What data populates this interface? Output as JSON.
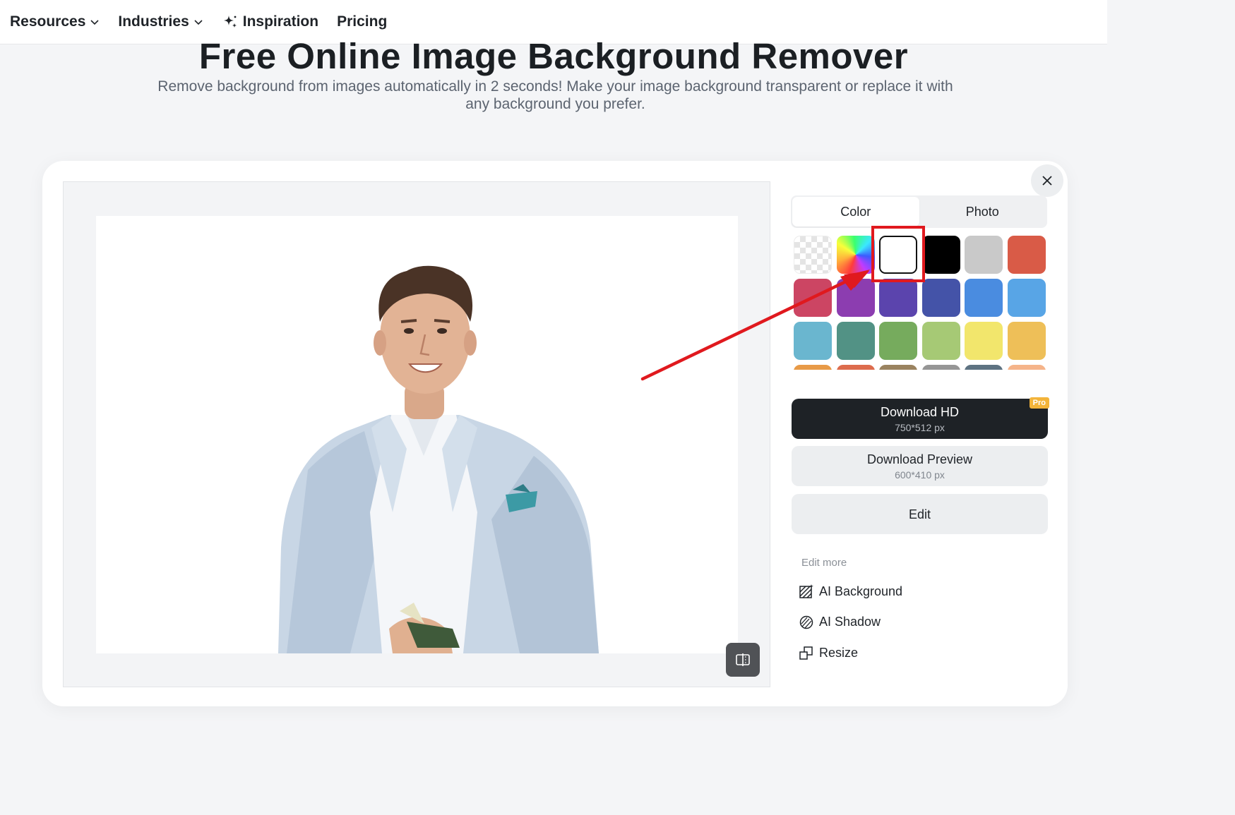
{
  "nav": {
    "items": [
      {
        "label": "Resources",
        "has_dropdown": true
      },
      {
        "label": "Industries",
        "has_dropdown": true
      },
      {
        "label": "Inspiration",
        "icon": "sparkle-icon"
      },
      {
        "label": "Pricing"
      }
    ]
  },
  "hero": {
    "title": "Free Online Image Background Remover",
    "subtitle_line1": "Remove background from images automatically in 2 seconds! Make your image background transparent or replace it with",
    "subtitle_line2": "any background you prefer."
  },
  "editor": {
    "tabs": [
      {
        "label": "Color",
        "active": true
      },
      {
        "label": "Photo",
        "active": false
      }
    ],
    "swatches": [
      {
        "type": "transparent",
        "color": "transparent"
      },
      {
        "type": "picker",
        "color": "rainbow"
      },
      {
        "type": "solid",
        "color": "#ffffff",
        "selected": true
      },
      {
        "type": "solid",
        "color": "#000000"
      },
      {
        "type": "solid",
        "color": "#c9c9c9"
      },
      {
        "type": "solid",
        "color": "#d95b47"
      },
      {
        "type": "solid",
        "color": "#cc4563"
      },
      {
        "type": "solid",
        "color": "#8c3db0"
      },
      {
        "type": "solid",
        "color": "#5b44ad"
      },
      {
        "type": "solid",
        "color": "#4453a8"
      },
      {
        "type": "solid",
        "color": "#4a8ce0"
      },
      {
        "type": "solid",
        "color": "#58a5e6"
      },
      {
        "type": "solid",
        "color": "#6ab6cf"
      },
      {
        "type": "solid",
        "color": "#529285"
      },
      {
        "type": "solid",
        "color": "#76ab5d"
      },
      {
        "type": "solid",
        "color": "#a6c975"
      },
      {
        "type": "solid",
        "color": "#f2e66c"
      },
      {
        "type": "solid",
        "color": "#eebf58"
      },
      {
        "type": "solid",
        "color": "#e89a47"
      },
      {
        "type": "solid",
        "color": "#dd6c4d"
      },
      {
        "type": "solid",
        "color": "#9a8360"
      },
      {
        "type": "solid",
        "color": "#969696"
      },
      {
        "type": "solid",
        "color": "#5e7382"
      },
      {
        "type": "solid",
        "color": "#f5b48a"
      }
    ],
    "download_hd": {
      "label": "Download HD",
      "size": "750*512 px",
      "badge": "Pro"
    },
    "download_preview": {
      "label": "Download Preview",
      "size": "600*410 px"
    },
    "edit_button": "Edit",
    "edit_more_label": "Edit more",
    "tools": [
      {
        "label": "AI Background",
        "icon": "ai-background-icon"
      },
      {
        "label": "AI Shadow",
        "icon": "ai-shadow-icon"
      },
      {
        "label": "Resize",
        "icon": "resize-icon"
      }
    ]
  },
  "colors": {
    "annotation_red": "#e0191e",
    "dark_button": "#1e2226",
    "pro_badge": "#f3b43a"
  }
}
